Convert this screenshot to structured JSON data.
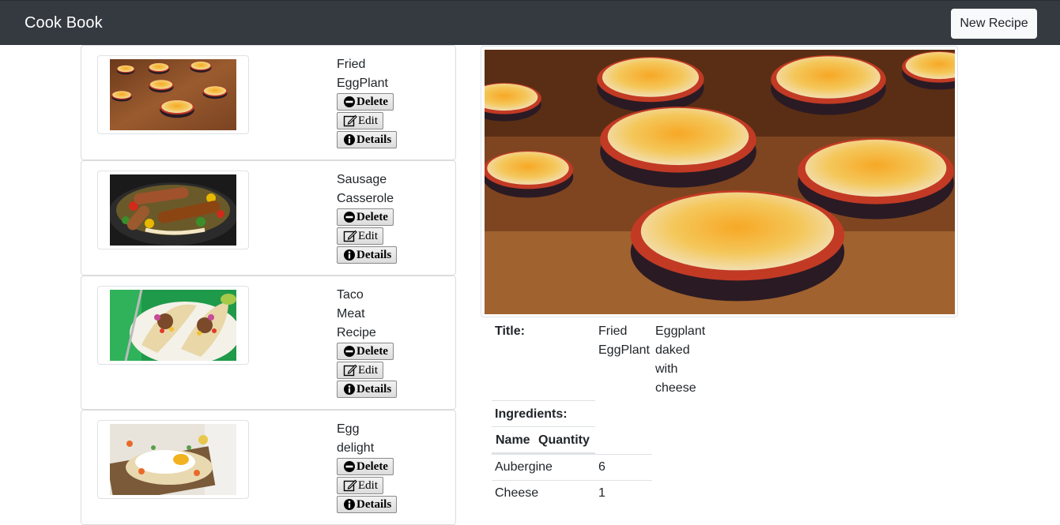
{
  "navbar": {
    "brand": "Cook Book",
    "new_recipe_label": "New Recipe"
  },
  "actions": {
    "delete": "Delete",
    "edit": "Edit",
    "details": "Details"
  },
  "recipes": [
    {
      "title_lines": [
        "Fried",
        "EggPlant"
      ],
      "image": "fried-eggplant"
    },
    {
      "title_lines": [
        "Sausage",
        "Casserole"
      ],
      "image": "sausage-casserole"
    },
    {
      "title_lines": [
        "Taco",
        "Meat",
        "Recipe"
      ],
      "image": "taco-meat"
    },
    {
      "title_lines": [
        "Egg",
        "delight"
      ],
      "image": "egg-delight"
    }
  ],
  "detail": {
    "title_label": "Title:",
    "title_lines": [
      "Fried",
      "EggPlant"
    ],
    "description_lines": [
      "Eggplant",
      "daked",
      "with",
      "cheese"
    ],
    "ingredients_label": "Ingredients:",
    "columns": [
      "Name",
      "Quantity"
    ],
    "ingredients": [
      {
        "name": "Aubergine",
        "quantity": "6"
      },
      {
        "name": "Cheese",
        "quantity": "1"
      }
    ]
  },
  "icons": {
    "delete": "minus-circle-icon",
    "edit": "edit-icon",
    "details": "info-circle-icon"
  },
  "colors": {
    "navbar": "#343a40",
    "button_light": "#f8f9fa",
    "border": "#dee2e6"
  }
}
